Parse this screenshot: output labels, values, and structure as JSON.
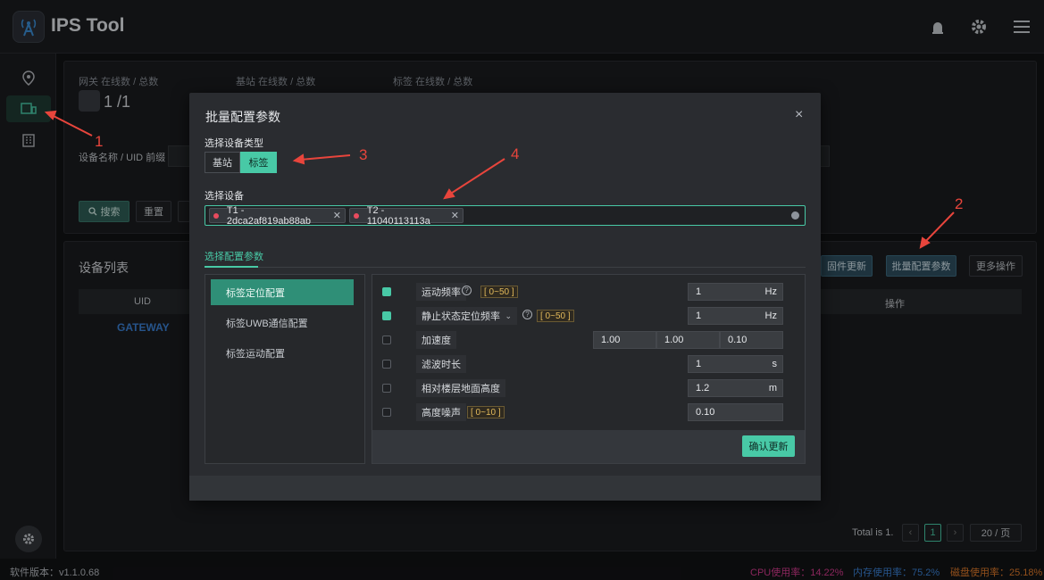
{
  "app": {
    "title": "IPS Tool"
  },
  "stats": {
    "gateway_label": "网关 在线数 / 总数",
    "gateway_value": "1 /1",
    "station_label": "基站 在线数 / 总数",
    "tag_label": "标签 在线数 / 总数"
  },
  "filter": {
    "device_label": "设备名称 / UID 前缀",
    "search_btn": "搜索",
    "reset_btn": "重置"
  },
  "device_list": {
    "title": "设备列表",
    "firmware_btn": "固件更新",
    "batch_btn": "批量配置参数",
    "more_btn": "更多操作",
    "col_uid": "UID",
    "col_ops": "操作",
    "row1_uid": "GATEWAY",
    "total": "Total is 1.",
    "page": "1",
    "page_size": "20 / 页"
  },
  "dialog": {
    "title": "批量配置参数",
    "device_type_label": "选择设备类型",
    "type_options": [
      "基站",
      "标签"
    ],
    "select_device_label": "选择设备",
    "selected_devices": [
      "T1 - 2dca2af819ab88ab",
      "T2 - 11040113113a"
    ],
    "config_tab": "选择配置参数",
    "config_nav": [
      "标签定位配置",
      "标签UWB通信配置",
      "标签运动配置"
    ],
    "params": [
      {
        "label": "运动频率",
        "range": "[ 0~50 ]",
        "value": "1",
        "unit": "Hz",
        "checked": true
      },
      {
        "label": "静止状态定位频率",
        "range": "[ 0~50 ]",
        "value": "1",
        "unit": "Hz",
        "checked": true
      },
      {
        "label": "加速度",
        "values": [
          "1.00",
          "1.00",
          "0.10"
        ],
        "checked": false
      },
      {
        "label": "滤波时长",
        "value": "1",
        "unit": "s",
        "checked": false
      },
      {
        "label": "相对楼层地面高度",
        "value": "1.2",
        "unit": "m",
        "checked": false
      },
      {
        "label": "高度噪声",
        "range": "[ 0~10 ]",
        "value": "0.10",
        "checked": false
      }
    ],
    "confirm_btn": "确认更新"
  },
  "footer": {
    "version": "软件版本：v1.1.0.68",
    "cpu": "CPU使用率：14.22%",
    "mem": "内存使用率：75.2%",
    "disk": "磁盘使用率：25.18%"
  },
  "annotations": [
    "1",
    "2",
    "3",
    "4"
  ],
  "colors": {
    "accent": "#48c9a6",
    "cpu": "#d63b8f",
    "mem": "#3b82d6",
    "disk": "#e07a2a"
  }
}
